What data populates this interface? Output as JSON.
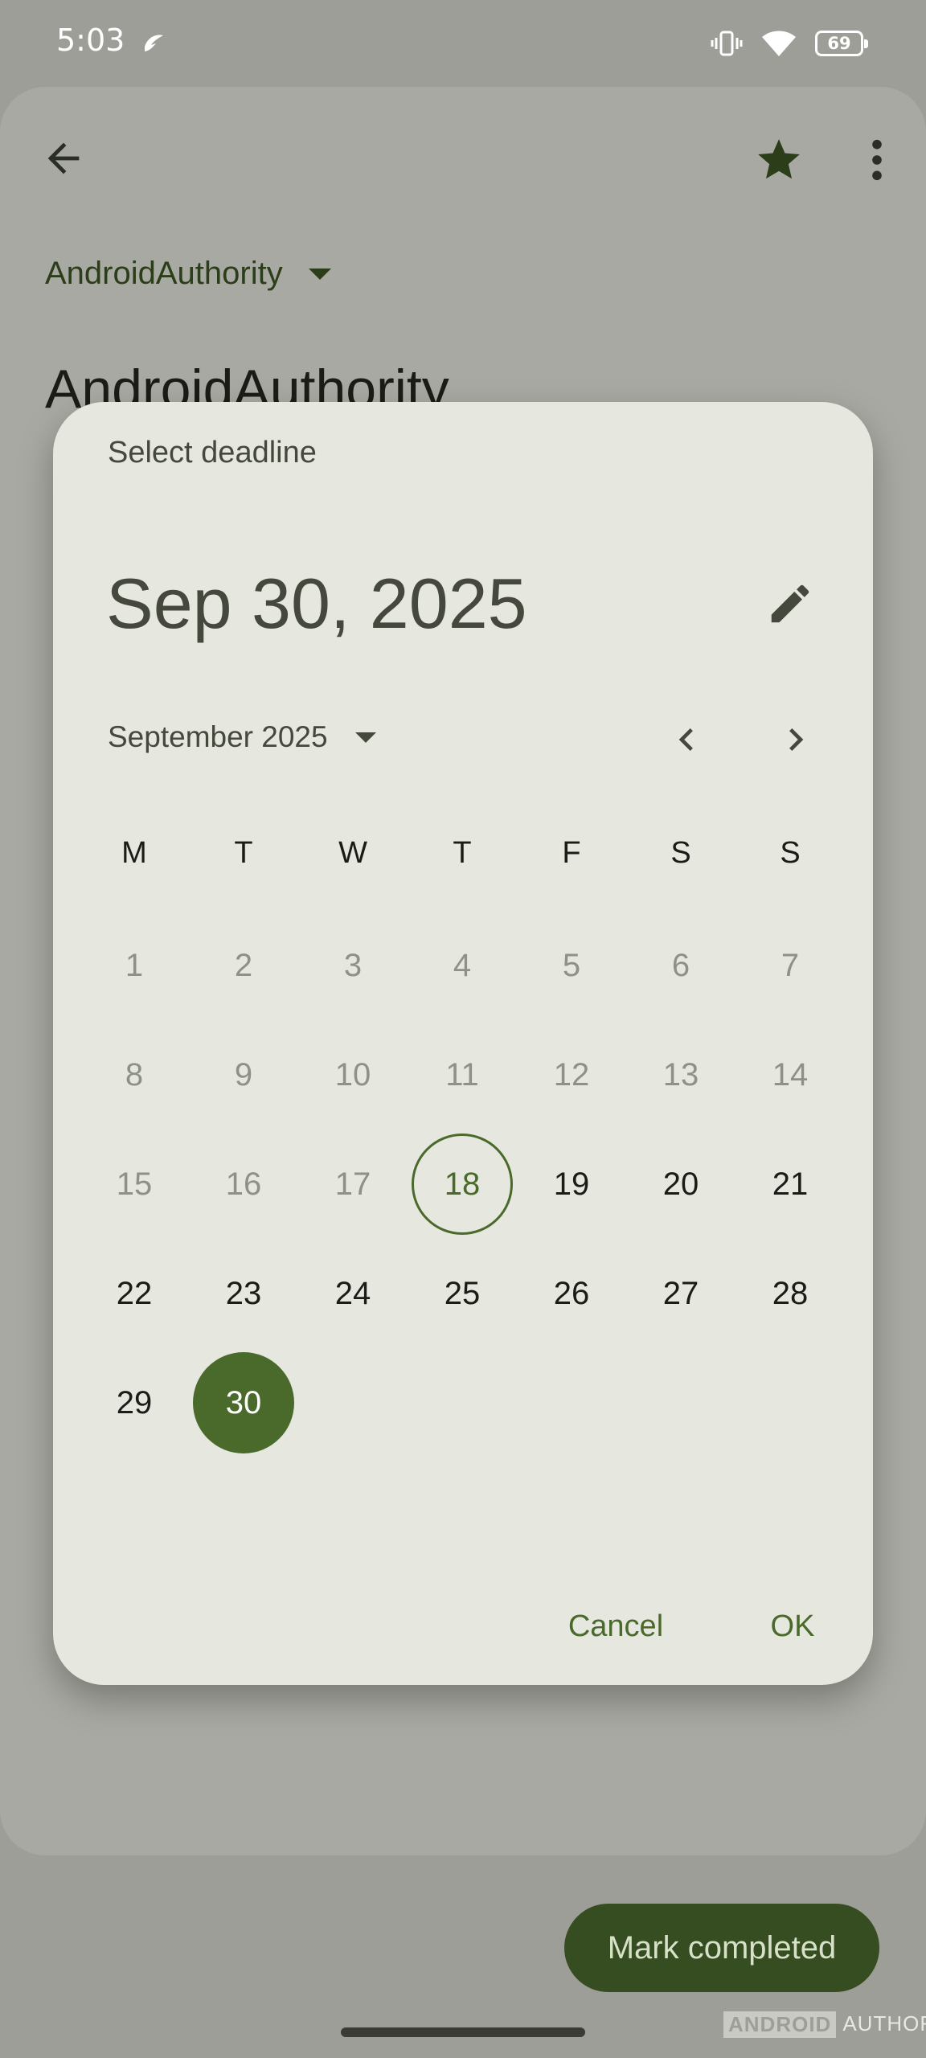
{
  "status_bar": {
    "time": "5:03",
    "battery_level": "69",
    "icons": [
      "app-notification-icon",
      "vibrate-icon",
      "wifi-icon",
      "battery-icon"
    ]
  },
  "task_screen": {
    "list_name": "AndroidAuthority",
    "title": "AndroidAuthority",
    "icons": [
      "back-arrow-icon",
      "star-icon",
      "more-vert-icon"
    ]
  },
  "date_picker": {
    "headline": "Select deadline",
    "selected_date": "Sep 30, 2025",
    "month_label": "September 2025",
    "weekdays": [
      "M",
      "T",
      "W",
      "T",
      "F",
      "S",
      "S"
    ],
    "days": [
      {
        "label": "1",
        "state": "disabled"
      },
      {
        "label": "2",
        "state": "disabled"
      },
      {
        "label": "3",
        "state": "disabled"
      },
      {
        "label": "4",
        "state": "disabled"
      },
      {
        "label": "5",
        "state": "disabled"
      },
      {
        "label": "6",
        "state": "disabled"
      },
      {
        "label": "7",
        "state": "disabled"
      },
      {
        "label": "8",
        "state": "disabled"
      },
      {
        "label": "9",
        "state": "disabled"
      },
      {
        "label": "10",
        "state": "disabled"
      },
      {
        "label": "11",
        "state": "disabled"
      },
      {
        "label": "12",
        "state": "disabled"
      },
      {
        "label": "13",
        "state": "disabled"
      },
      {
        "label": "14",
        "state": "disabled"
      },
      {
        "label": "15",
        "state": "disabled"
      },
      {
        "label": "16",
        "state": "disabled"
      },
      {
        "label": "17",
        "state": "disabled"
      },
      {
        "label": "18",
        "state": "today"
      },
      {
        "label": "19",
        "state": "normal"
      },
      {
        "label": "20",
        "state": "normal"
      },
      {
        "label": "21",
        "state": "normal"
      },
      {
        "label": "22",
        "state": "normal"
      },
      {
        "label": "23",
        "state": "normal"
      },
      {
        "label": "24",
        "state": "normal"
      },
      {
        "label": "25",
        "state": "normal"
      },
      {
        "label": "26",
        "state": "normal"
      },
      {
        "label": "27",
        "state": "normal"
      },
      {
        "label": "28",
        "state": "normal"
      },
      {
        "label": "29",
        "state": "normal"
      },
      {
        "label": "30",
        "state": "selected"
      }
    ],
    "cancel_label": "Cancel",
    "ok_label": "OK",
    "icons": [
      "edit-icon",
      "chevron-left-icon",
      "chevron-right-icon",
      "dropdown-arrow-icon"
    ]
  },
  "fab": {
    "label": "Mark completed"
  },
  "watermark": {
    "brand_box": "ANDROID",
    "brand_text": "AUTHORITY"
  },
  "colors": {
    "accent": "#4a6a2c",
    "fab": "#364c21",
    "dialog": "#e6e8e0",
    "scrim": "#9d9e97"
  }
}
